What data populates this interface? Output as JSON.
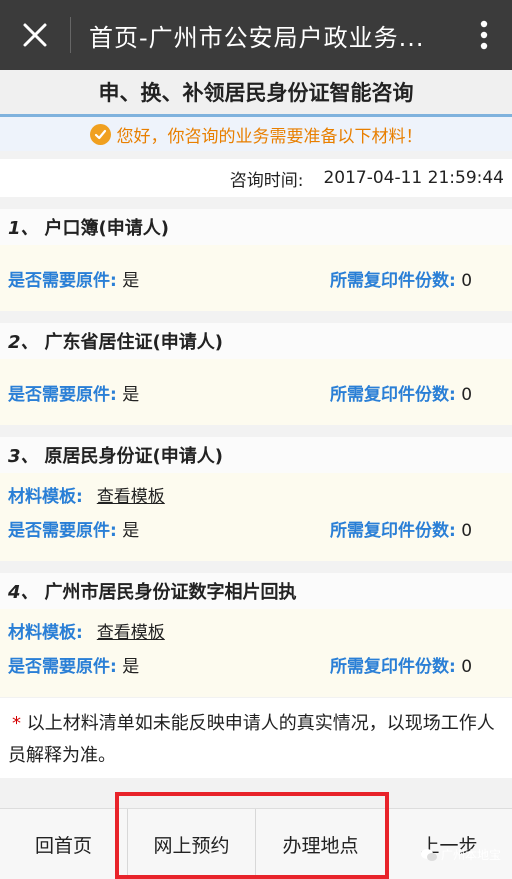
{
  "topbar": {
    "title": "首页-广州市公安局户政业务..."
  },
  "heading": "申、换、补领居民身份证智能咨询",
  "notice": "您好，你咨询的业务需要准备以下材料！",
  "consult": {
    "label": "咨询时间:",
    "value": "2017-04-11 21:59:44"
  },
  "items": [
    {
      "num": "1、",
      "title": "户口簿(申请人)",
      "original_label": "是否需要原件:",
      "original_value": "是",
      "copies_label": "所需复印件份数:",
      "copies_value": "0"
    },
    {
      "num": "2、",
      "title": "广东省居住证(申请人)",
      "original_label": "是否需要原件:",
      "original_value": "是",
      "copies_label": "所需复印件份数:",
      "copies_value": "0"
    },
    {
      "num": "3、",
      "title": "原居民身份证(申请人)",
      "template_label": "材料模板:",
      "template_link": "查看模板",
      "original_label": "是否需要原件:",
      "original_value": "是",
      "copies_label": "所需复印件份数:",
      "copies_value": "0"
    },
    {
      "num": "4、",
      "title": "广州市居民身份证数字相片回执",
      "template_label": "材料模板:",
      "template_link": "查看模板",
      "original_label": "是否需要原件:",
      "original_value": "是",
      "copies_label": "所需复印件份数:",
      "copies_value": "0"
    }
  ],
  "disclaimer": {
    "star": "*",
    "text": "以上材料清单如未能反映申请人的真实情况，以现场工作人员解释为准。"
  },
  "bottom": {
    "home": "回首页",
    "booking": "网上预约",
    "location": "办理地点",
    "prev": "上一步"
  },
  "watermark": "广州本地宝",
  "colors": {
    "accent_blue": "#2a7fd6",
    "notice_orange": "#e87f00",
    "highlight_red": "#e8232a"
  }
}
